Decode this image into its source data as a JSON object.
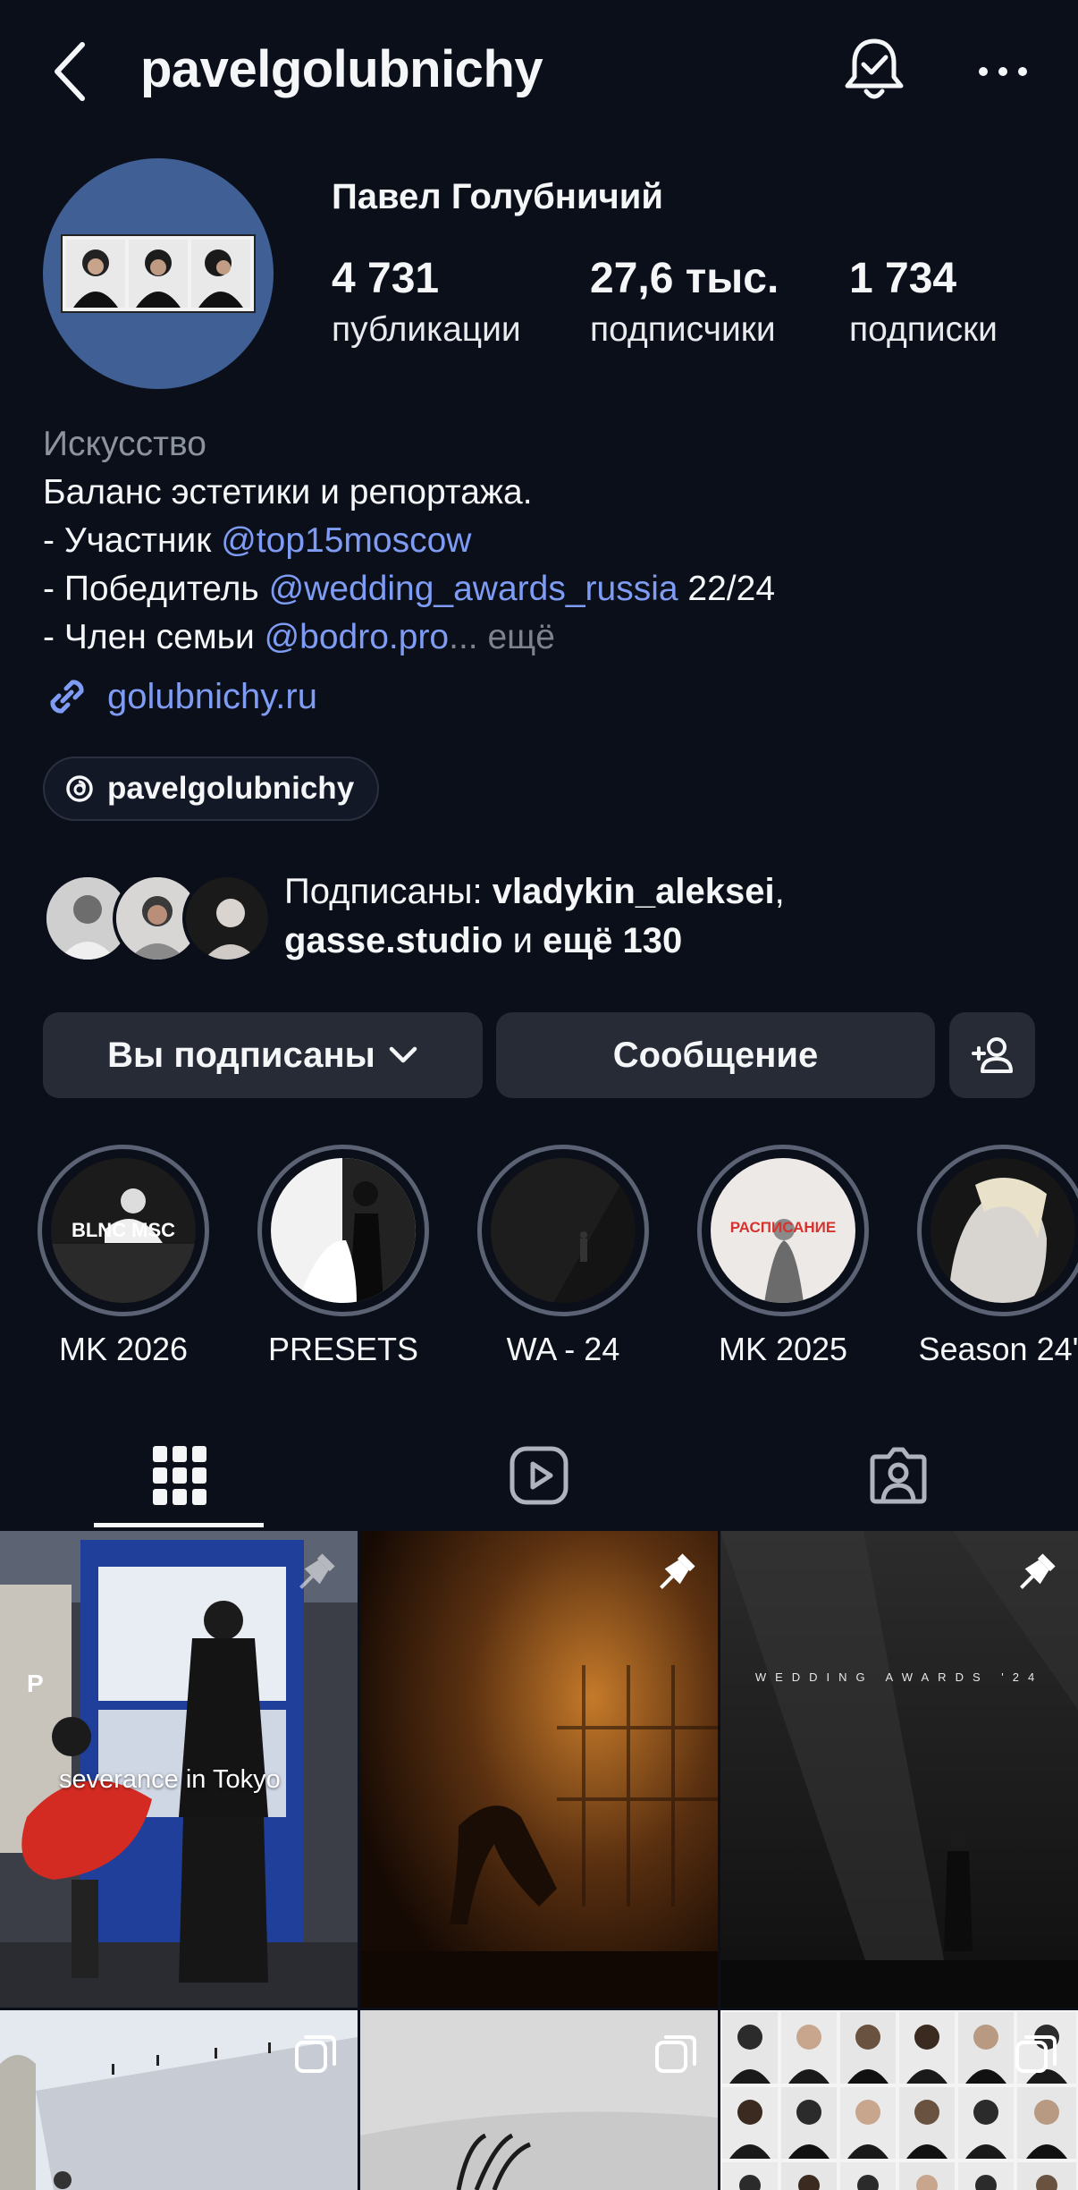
{
  "header": {
    "username": "pavelgolubnichy"
  },
  "profile": {
    "full_name": "Павел Голубничий",
    "stats": [
      {
        "value": "4 731",
        "label": "публикации"
      },
      {
        "value": "27,6 тыс.",
        "label": "подписчики"
      },
      {
        "value": "1 734",
        "label": "подписки"
      }
    ],
    "category": "Искусство",
    "bio": {
      "line1": "Баланс эстетики и репортажа.",
      "line2_prefix": "- Участник ",
      "line2_mention": "@top15moscow",
      "line3_prefix": "- Победитель ",
      "line3_mention": "@wedding_awards_russia",
      "line3_suffix": " 22/24",
      "line4_prefix": "- Член семьи ",
      "line4_mention": "@bodro.pro",
      "line4_more": "... ещё"
    },
    "website": "golubnichy.ru",
    "threads_handle": "pavelgolubnichy"
  },
  "followed_by": {
    "prefix": "Подписаны: ",
    "user1": "vladykin_aleksei",
    "sep": ",",
    "user2": "gasse.studio",
    "mid": " и ",
    "more": "ещё 130"
  },
  "actions": {
    "following_label": "Вы подписаны",
    "message_label": "Сообщение"
  },
  "highlights": [
    {
      "label": "MK 2026",
      "badge": "BLNC MSC"
    },
    {
      "label": "PRESETS"
    },
    {
      "label": "WA - 24"
    },
    {
      "label": "MK 2025",
      "badge": "РАСПИСАНИЕ"
    },
    {
      "label": "Season 24'."
    }
  ],
  "grid": {
    "tile1_caption": "severance in Tokyo",
    "tile3_caption": "WEDDING AWARDS '24"
  },
  "colors": {
    "background": "#0b0f1a",
    "link": "#7f9cf5",
    "button": "#262b35"
  }
}
